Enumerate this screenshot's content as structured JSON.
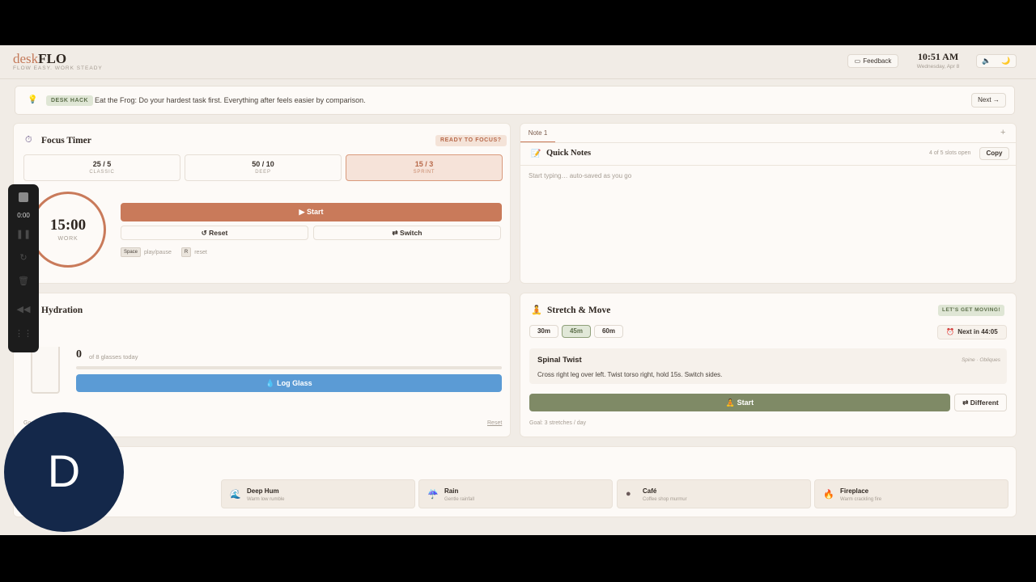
{
  "header": {
    "logo_a": "desk",
    "logo_b": "FLO",
    "tagline": "FLOW EASY. WORK STEADY",
    "feedback_label": "Feedback",
    "time": "10:51 AM",
    "date": "Wednesday, Apr 8"
  },
  "hack": {
    "tag": "DESK HACK",
    "text": "Eat the Frog: Do your hardest task first. Everything after feels easier by comparison.",
    "next_label": "Next →"
  },
  "focus": {
    "title": "Focus Timer",
    "status": "READY TO FOCUS?",
    "presets": [
      {
        "value": "25 / 5",
        "label": "CLASSIC"
      },
      {
        "value": "50 / 10",
        "label": "DEEP"
      },
      {
        "value": "15 / 3",
        "label": "SPRINT"
      }
    ],
    "active_preset": "SPRINT",
    "time": "15:00",
    "mode": "WORK",
    "start_label": "▶ Start",
    "reset_label": "↺ Reset",
    "switch_label": "⇄ Switch",
    "key_space": "Space",
    "key_space_hint": "play/pause",
    "key_r": "R",
    "key_r_hint": "reset"
  },
  "notes": {
    "tab": "Note 1",
    "add_label": "+",
    "title": "Quick Notes",
    "slots": "4 of 5 slots open",
    "copy_label": "Copy",
    "placeholder": "Start typing… auto-saved as you go"
  },
  "hydration": {
    "title": "Hydration",
    "count": "0",
    "count_label": "of 8 glasses today",
    "progress": 0,
    "log_label": "💧 Log Glass",
    "goal_partial": "Go",
    "reset_label": "Reset"
  },
  "stretch": {
    "title": "Stretch & Move",
    "status": "LET'S GET MOVING!",
    "intervals": [
      "30m",
      "45m",
      "60m"
    ],
    "active_interval": "45m",
    "next_label": "Next in",
    "next_time": "44:05",
    "exercise_name": "Spinal Twist",
    "exercise_area": "Spine · Obliques",
    "exercise_desc": "Cross right leg over left. Twist torso right, hold 15s. Switch sides.",
    "start_label": "🧘 Start",
    "different_label": "⇄ Different",
    "goal": "Goal: 3 stretches / day"
  },
  "sounds": [
    {
      "icon": "water-wave-icon",
      "glyph": "🌊",
      "name": "Deep Hum",
      "desc": "Warm low rumble"
    },
    {
      "icon": "rain-icon",
      "glyph": "☔",
      "name": "Rain",
      "desc": "Gentle rainfall"
    },
    {
      "icon": "coffee-icon",
      "glyph": "●",
      "name": "Café",
      "desc": "Coffee shop murmur"
    },
    {
      "icon": "fire-icon",
      "glyph": "🔥",
      "name": "Fireplace",
      "desc": "Warm crackling fire"
    }
  ],
  "recorder": {
    "elapsed": "0:00"
  },
  "avatar": {
    "initial": "D"
  },
  "colors": {
    "accent": "#c97a5a",
    "water": "#5b9bd5",
    "sage": "#7f8a66",
    "background": "#f1ece6"
  }
}
